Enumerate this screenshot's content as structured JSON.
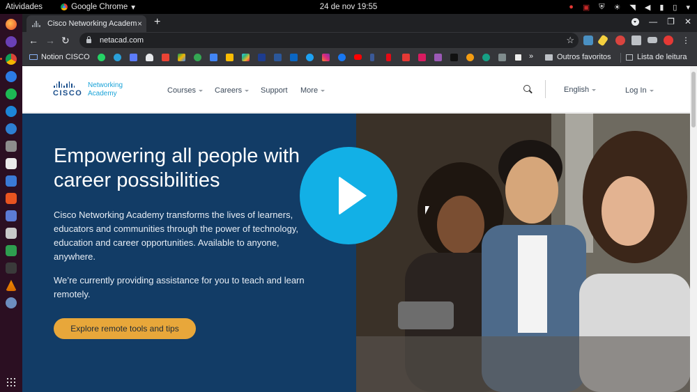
{
  "system_bar": {
    "activities": "Atividades",
    "app_name": "Google Chrome",
    "app_caret": "▾",
    "clock": "24 de nov  19:55"
  },
  "browser": {
    "tab_title": "Cisco Networking Academ",
    "tab_close": "×",
    "new_tab": "+",
    "url": "netacad.com",
    "bookmarks": {
      "notion": "Notion CISCO",
      "more": "»",
      "other_favorites": "Outros favoritos",
      "reading_list": "Lista de leitura"
    }
  },
  "site": {
    "logo": {
      "wordmark": "CISCO",
      "line1": "Networking",
      "line2": "Academy"
    },
    "nav": {
      "courses": "Courses",
      "careers": "Careers",
      "support": "Support",
      "more": "More",
      "language": "English",
      "login": "Log In"
    },
    "hero": {
      "title": "Empowering all people with career possibilities",
      "paragraph1": "Cisco Networking Academy transforms the lives of learners, educators and communities through the power of technology, education and career opportunities. Available to anyone, anywhere.",
      "paragraph2": "We’re currently providing assistance for you to teach and learn remotely.",
      "cta": "Explore remote tools and tips"
    }
  },
  "colors": {
    "hero_bg": "#123c66",
    "cta": "#e8a73a",
    "play_button": "#12b0e6",
    "dock": "#2b0f22"
  }
}
